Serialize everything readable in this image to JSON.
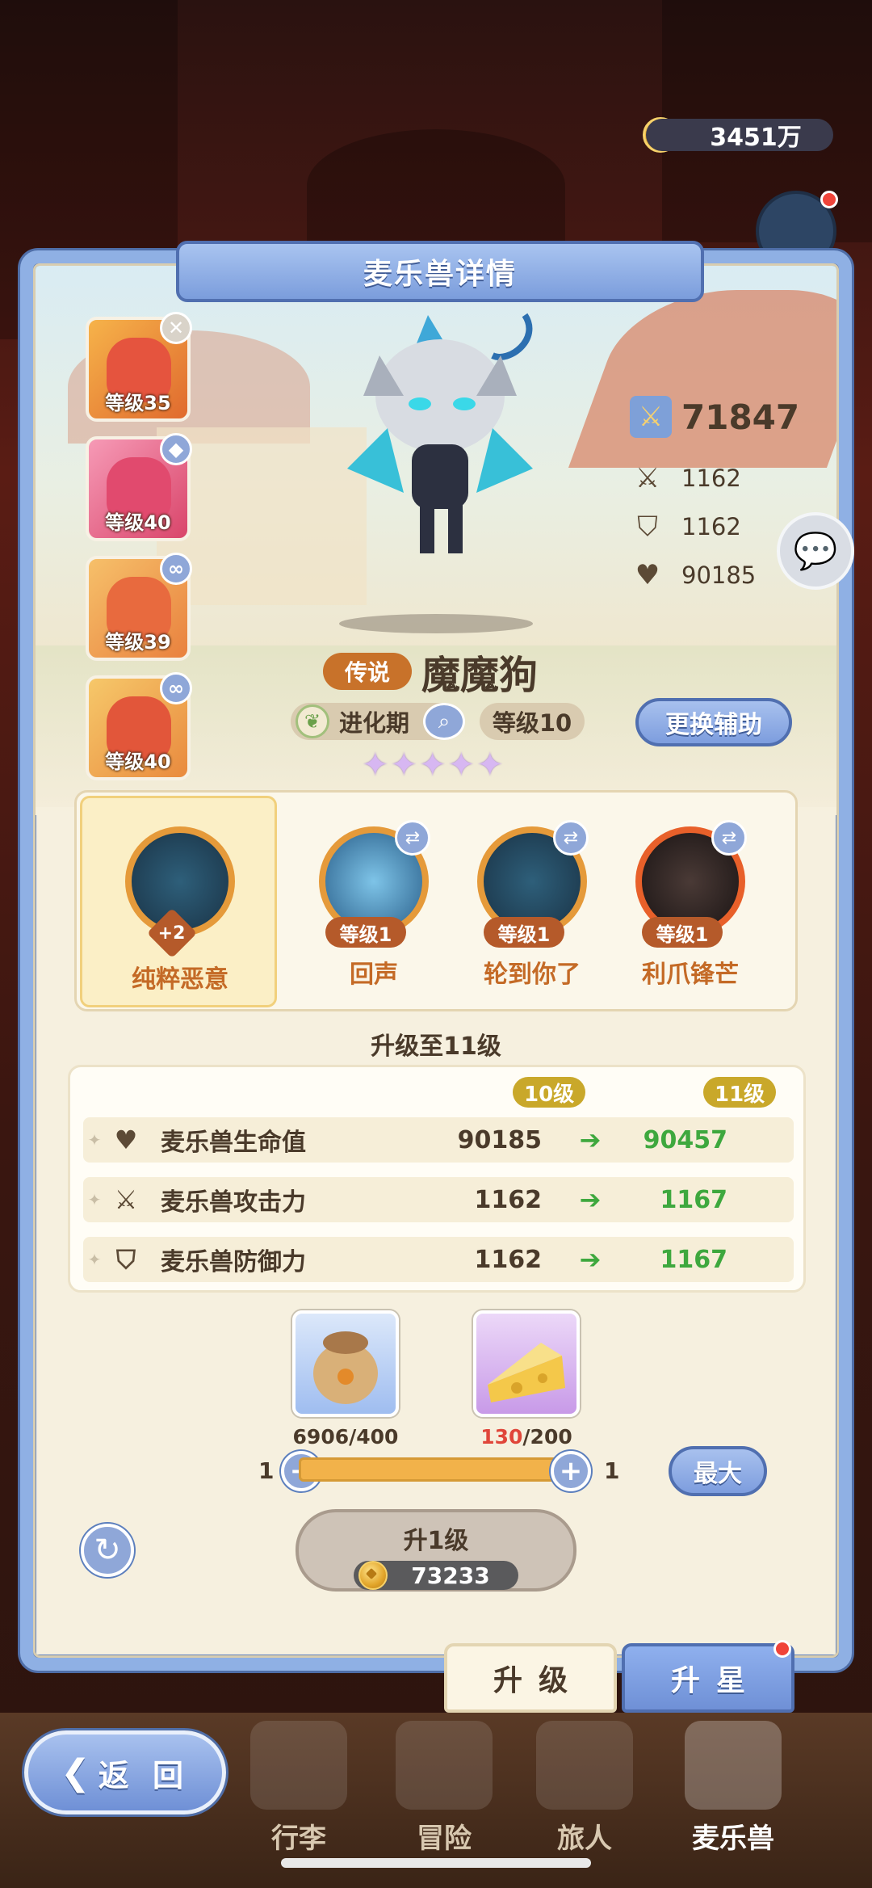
{
  "currency": {
    "gold": "3451万"
  },
  "panel": {
    "title": "麦乐兽详情"
  },
  "side_cards": [
    {
      "level": "等级35",
      "badge": "✕"
    },
    {
      "level": "等级40",
      "badge": "◆"
    },
    {
      "level": "等级39",
      "badge": "∞"
    },
    {
      "level": "等级40",
      "badge": "∞"
    }
  ],
  "stats": {
    "power": "71847",
    "attack": "1162",
    "defense": "1162",
    "hp": "90185"
  },
  "monster": {
    "rarity": "传说",
    "name": "魔魔狗",
    "stage": "进化期",
    "level": "等级10",
    "stars": [
      "✦",
      "✦",
      "✦",
      "✦",
      "✦"
    ]
  },
  "buttons": {
    "swap_assist": "更换辅助",
    "max": "最大",
    "level_up": "升1级",
    "back": "返 回"
  },
  "skills": {
    "main": {
      "name": "纯粹恶意",
      "plus": "+2"
    },
    "list": [
      {
        "name": "回声",
        "level": "等级1"
      },
      {
        "name": "轮到你了",
        "level": "等级1"
      },
      {
        "name": "利爪锋芒",
        "level": "等级1"
      }
    ]
  },
  "upgrade": {
    "title": "升级至11级",
    "from_label": "10级",
    "to_label": "11级",
    "rows": [
      {
        "icon": "heart-icon",
        "label": "麦乐兽生命值",
        "from": "90185",
        "to": "90457"
      },
      {
        "icon": "sword-icon",
        "label": "麦乐兽攻击力",
        "from": "1162",
        "to": "1167"
      },
      {
        "icon": "shield-icon",
        "label": "麦乐兽防御力",
        "from": "1162",
        "to": "1167"
      }
    ]
  },
  "materials": {
    "food_have": "6906",
    "food_need": "/400",
    "cheese_have": "130",
    "cheese_need": "/200"
  },
  "slider": {
    "min": "1",
    "max": "1"
  },
  "cost": "73233",
  "tabs": {
    "level": "升级",
    "star": "升星"
  },
  "nav": [
    "行李",
    "冒险",
    "旅人",
    "麦乐兽"
  ],
  "colors": {
    "accent_blue": "#8fa7d8",
    "gain_green": "#3ea83e",
    "rarity_orange": "#c8722a"
  }
}
